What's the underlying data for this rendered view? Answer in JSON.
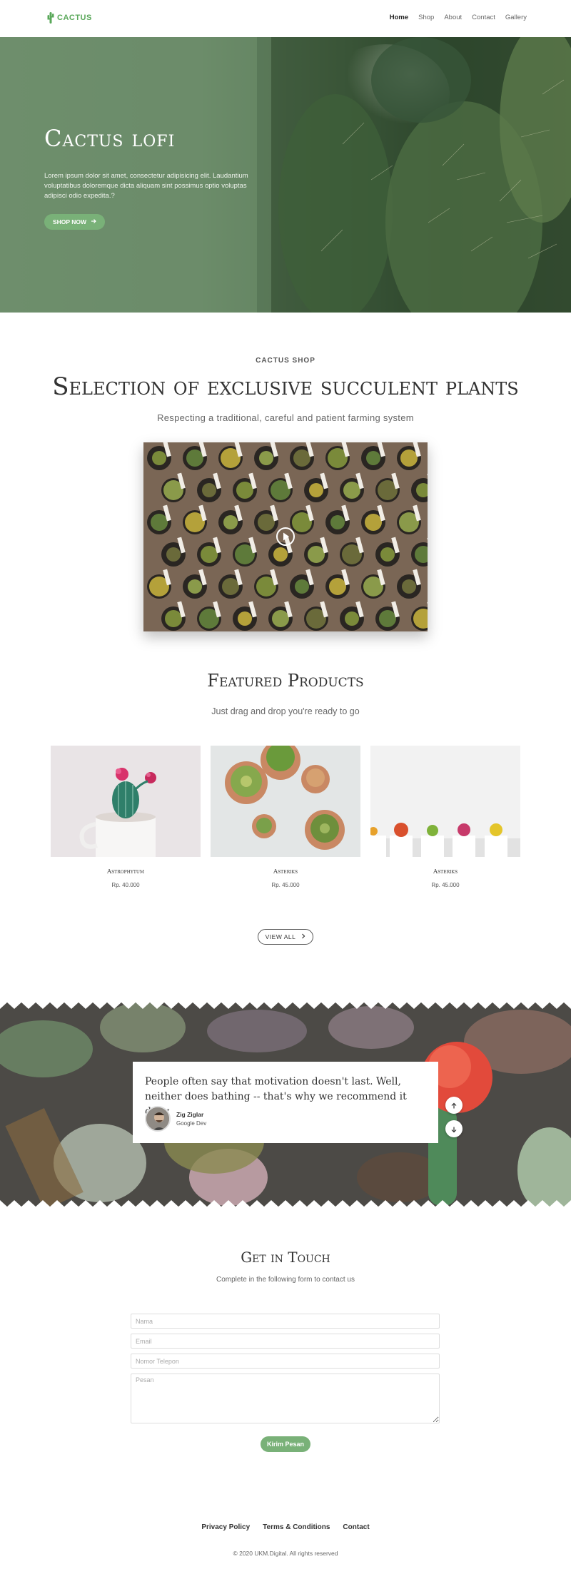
{
  "nav": {
    "logo_text": "CACTUS",
    "links": [
      {
        "label": "Home",
        "active": true
      },
      {
        "label": "Shop",
        "active": false
      },
      {
        "label": "About",
        "active": false
      },
      {
        "label": "Contact",
        "active": false
      },
      {
        "label": "Gallery",
        "active": false
      }
    ]
  },
  "hero": {
    "title": "Cactus lofi",
    "text": "Lorem ipsum dolor sit amet, consectetur adipisicing elit. Laudantium voluptatibus doloremque dicta aliquam sint possimus optio voluptas adipisci odio expedita.?",
    "button_label": "SHOP NOW"
  },
  "shop": {
    "kicker": "CACTUS SHOP",
    "title": "Selection of exclusive succulent plants",
    "subtitle": "Respecting a traditional, careful and patient farming system"
  },
  "featured": {
    "title": "Featured Products",
    "subtitle": "Just drag and drop you're ready to go",
    "products": [
      {
        "name": "Astrophytum",
        "price": "Rp. 40.000"
      },
      {
        "name": "Asteriks",
        "price": "Rp. 45.000"
      },
      {
        "name": "Asteriks",
        "price": "Rp. 45.000"
      }
    ],
    "view_all_label": "VIEW ALL"
  },
  "testimonial": {
    "quote": "People often say that motivation doesn't last. Well, neither does bathing -- that's why we recommend it daily",
    "author_name": "Zig Ziglar",
    "author_role": "Google Dev"
  },
  "contact": {
    "title": "Get in Touch",
    "subtitle": "Complete in the following form to contact us",
    "fields": {
      "name_placeholder": "Nama",
      "email_placeholder": "Email",
      "phone_placeholder": "Nomor Telepon",
      "message_placeholder": "Pesan"
    },
    "submit_label": "Kirim Pesan"
  },
  "footer": {
    "links": [
      "Privacy Policy",
      "Terms & Conditions",
      "Contact"
    ],
    "copyright": "© 2020 UKM.Digital. All rights reserved"
  },
  "colors": {
    "accent_green": "#79b178",
    "logo_green": "#5aa85a",
    "hero_green": "#6a8a68"
  }
}
